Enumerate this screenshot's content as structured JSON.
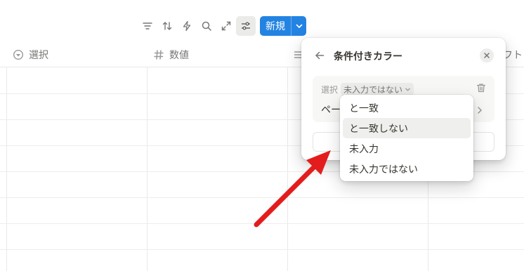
{
  "toolbar": {
    "icons": [
      "filter-icon",
      "sort-icon",
      "automation-icon",
      "search-icon",
      "expand-icon",
      "settings-icon"
    ],
    "new_label": "新規"
  },
  "table": {
    "columns": [
      {
        "label": "選択",
        "icon": "select-icon"
      },
      {
        "label": "数値",
        "icon": "hash-icon"
      },
      {
        "label": "",
        "icon": "list-icon"
      },
      {
        "label": "フト",
        "icon": ""
      }
    ]
  },
  "panel": {
    "title": "条件付きカラー",
    "rule": {
      "property": "選択",
      "condition": "未入力ではない",
      "target_partial": "ペー"
    }
  },
  "dropdown": {
    "options": [
      "と一致",
      "と一致しない",
      "未入力",
      "未入力ではない"
    ],
    "hovered_index": 1
  },
  "colors": {
    "accent": "#2383e2",
    "annotation_arrow": "#e31d1d"
  }
}
